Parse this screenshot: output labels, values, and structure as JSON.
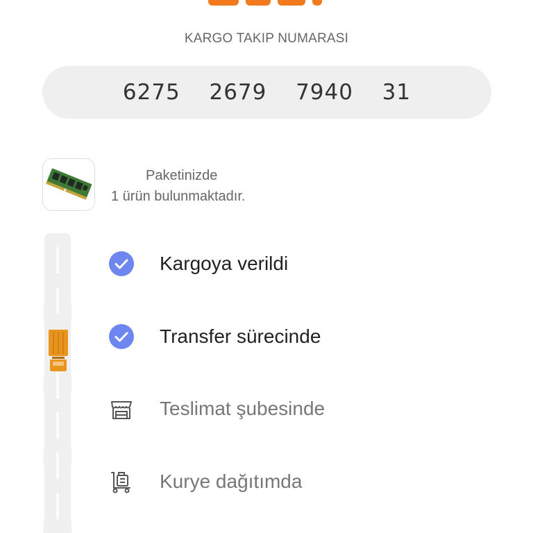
{
  "header": {
    "brand_logo": "trendyol-logo-cropped"
  },
  "tracking": {
    "label": "KARGO TAKIP NUMARASI",
    "number": "6275  2679  7940  31"
  },
  "package": {
    "line1": "Paketinizde",
    "line2": "1 ürün bulunmaktadır.",
    "product_image": "ram-module-image"
  },
  "timeline": {
    "steps": [
      {
        "label": "Kargoya verildi",
        "status": "done",
        "icon": "check-circle-icon"
      },
      {
        "label": "Transfer sürecinde",
        "status": "done",
        "icon": "check-circle-icon"
      },
      {
        "label": "Teslimat şubesinde",
        "status": "pending",
        "icon": "store-icon"
      },
      {
        "label": "Kurye dağıtımda",
        "status": "pending",
        "icon": "courier-dolly-icon"
      }
    ],
    "current_position_icon": "truck-icon"
  },
  "colors": {
    "accent": "#f27a1a",
    "check_blue": "#6e87f0",
    "truck_orange": "#e8951e",
    "road_gray": "#f0f0f0"
  }
}
